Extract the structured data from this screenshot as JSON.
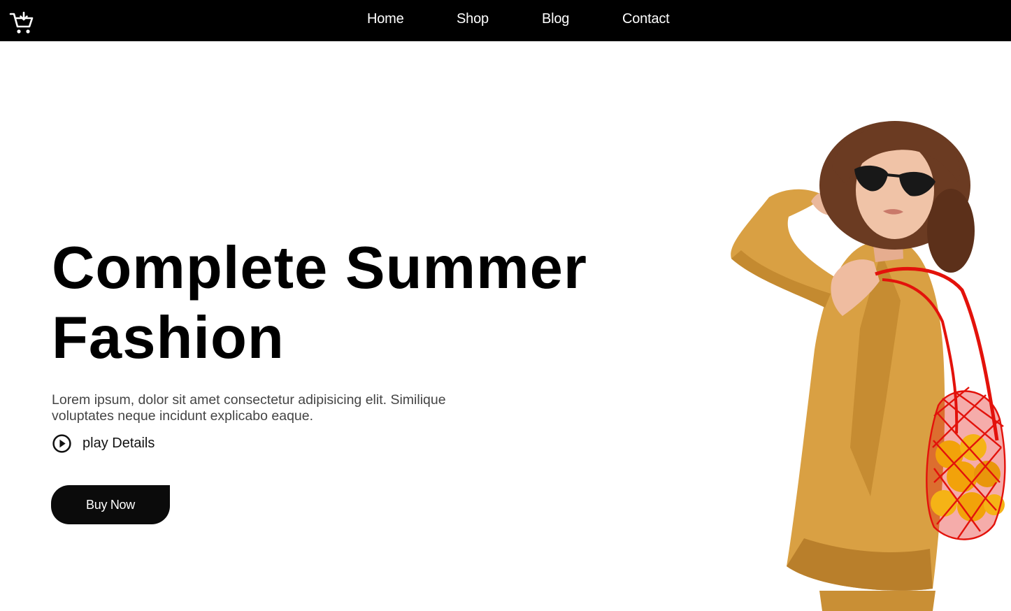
{
  "navbar": {
    "links": [
      {
        "label": "Home"
      },
      {
        "label": "Shop"
      },
      {
        "label": "Blog"
      },
      {
        "label": "Contact"
      }
    ]
  },
  "hero": {
    "title_line1": "Complete Summer",
    "title_line2": "Fashion",
    "description": "Lorem ipsum, dolor sit amet consectetur adipisicing elit. Similique voluptates neque incidunt explicabo eaque.",
    "play_label": "play Details",
    "buy_label": "Buy Now"
  },
  "colors": {
    "nav_bg": "#000000",
    "button_bg": "#0b0b0b",
    "jacket": "#d9a043",
    "bag": "#e3120b"
  }
}
